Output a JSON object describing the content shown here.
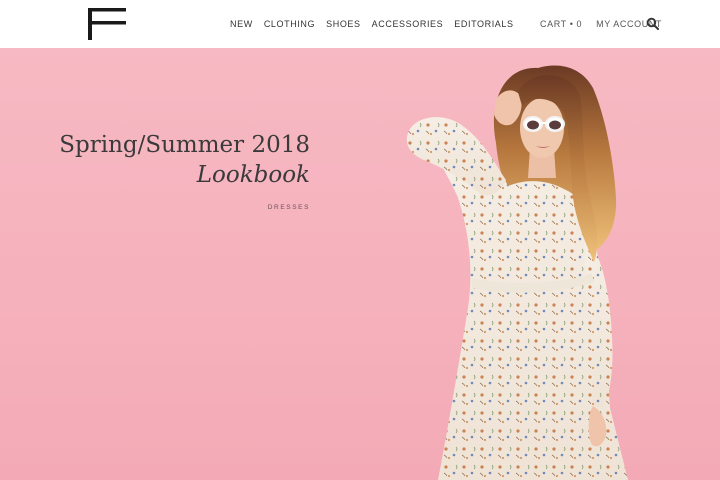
{
  "header": {
    "logo_text": "F",
    "nav": [
      "NEW",
      "CLOTHING",
      "SHOES",
      "ACCESSORIES",
      "EDITORIALS"
    ],
    "cart_label": "CART • 0",
    "account_label": "MY ACCOUNT",
    "search_icon": "search-icon"
  },
  "hero": {
    "title": "Spring/Summer 2018",
    "subtitle": "Lookbook",
    "link_label": "DRESSES",
    "background_color": "#f5b1bc"
  }
}
